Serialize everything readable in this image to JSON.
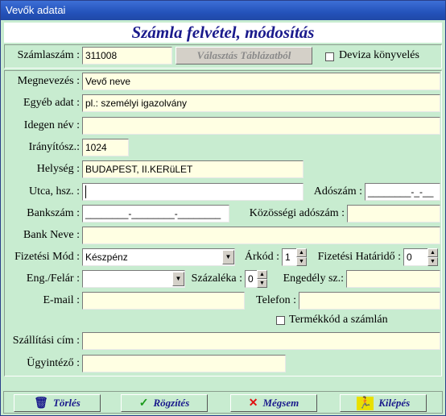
{
  "window": {
    "title": "Vevők adatai"
  },
  "heading": "Számla felvétel, módosítás",
  "top": {
    "szamlaszam_label": "Számlaszám :",
    "szamlaszam_value": "311008",
    "valasztas_button": "Választás Táblázatból",
    "deviza_label": "Deviza könyvelés"
  },
  "form": {
    "megnevezes_label": "Megnevezés :",
    "megnevezes_value": "Vevő neve",
    "egyeb_label": "Egyéb adat :",
    "egyeb_value": "pl.: személyi igazolvány",
    "idegen_label": "Idegen név :",
    "idegen_value": "",
    "iranyito_label": "Irányítósz.:",
    "iranyito_value": "1024",
    "helyseg_label": "Helység :",
    "helyseg_value": "BUDAPEST, II.KERüLET",
    "utca_label": "Utca, hsz. :",
    "utca_value": "",
    "adoszam_label": "Adószám :",
    "adoszam_value": "________-_-__",
    "bankszam_label": "Bankszám :",
    "bankszam_value": "________-________-________",
    "kozossegi_label": "Közösségi adószám :",
    "kozossegi_value": "",
    "bank_neve_label": "Bank Neve :",
    "bank_neve_value": "",
    "fizmod_label": "Fizetési Mód :",
    "fizmod_value": "Készpénz",
    "arkod_label": "Árkód :",
    "arkod_value": "1",
    "fizhat_label": "Fizetési Határidő :",
    "fizhat_value": "0",
    "engfelar_label": "Eng./Felár :",
    "engfelar_value": "",
    "szazalek_label": "Százaléka :",
    "szazalek_value": "0",
    "engedely_label": "Engedély sz.:",
    "engedely_value": "",
    "email_label": "E-mail :",
    "email_value": "",
    "telefon_label": "Telefon :",
    "telefon_value": "",
    "termekkod_label": "Termékkód a számlán",
    "szallitasi_label": "Szállítási cím :",
    "szallitasi_value": "",
    "ugyintezo_label": "Ügyintéző :",
    "ugyintezo_value": ""
  },
  "buttons": {
    "torles": "Törlés",
    "rogzites": "Rögzítés",
    "megsem": "Mégsem",
    "kilepes": "Kilépés"
  },
  "icons": {
    "torles": "trash-icon",
    "rogzites": "checkmark-icon",
    "megsem": "cross-icon",
    "kilepes": "exit-runner-icon"
  },
  "colors": {
    "background": "#c8ecd0",
    "field": "#ffffe3",
    "heading_text": "#1a1a8c",
    "titlebar": "#2453bb"
  }
}
